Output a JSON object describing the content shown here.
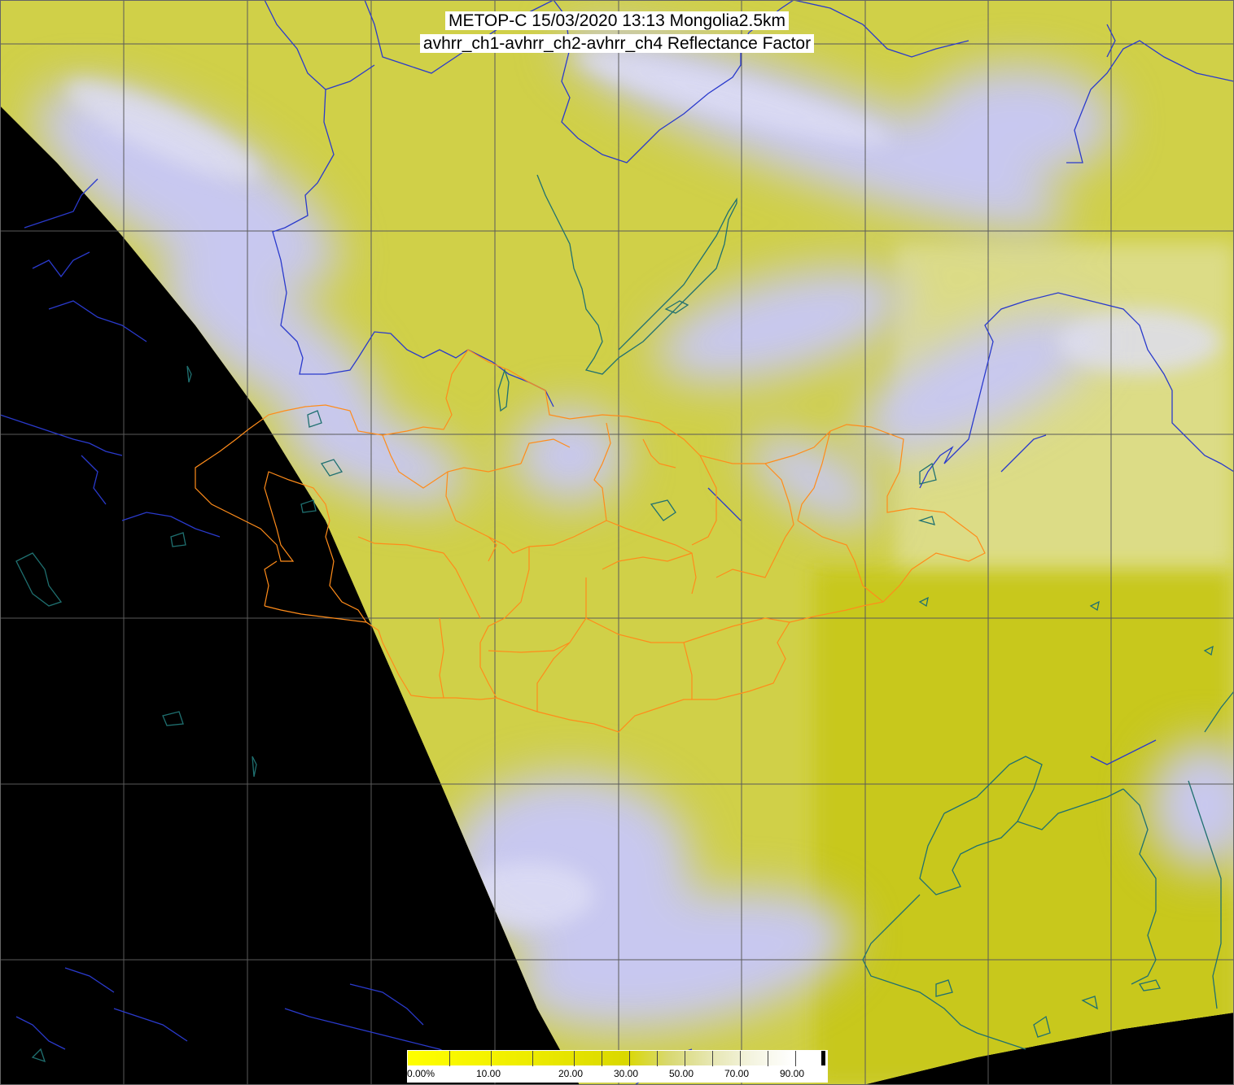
{
  "title": {
    "line1": "METOP-C 15/03/2020 13:13 Mongolia2.5km",
    "line2": "avhrr_ch1-avhrr_ch2-avhrr_ch4 Reflectance Factor"
  },
  "colorbar": {
    "labels": [
      "0.00%",
      "10.00",
      "20.00",
      "30.00",
      "50.00",
      "70.00",
      "90.00"
    ],
    "colors": {
      "low": "#ffff00",
      "mid": "#d8d800",
      "high": "#ffffff"
    }
  },
  "map_style": {
    "no_data_color": "#000000",
    "land_color": "#d4d44a",
    "cloud_color": "#c8c8f0",
    "grid_color": "#555555",
    "river_color": "#2233cc",
    "coast_color": "#1f6f6f",
    "admin_border_color": "#ff8c1a"
  }
}
